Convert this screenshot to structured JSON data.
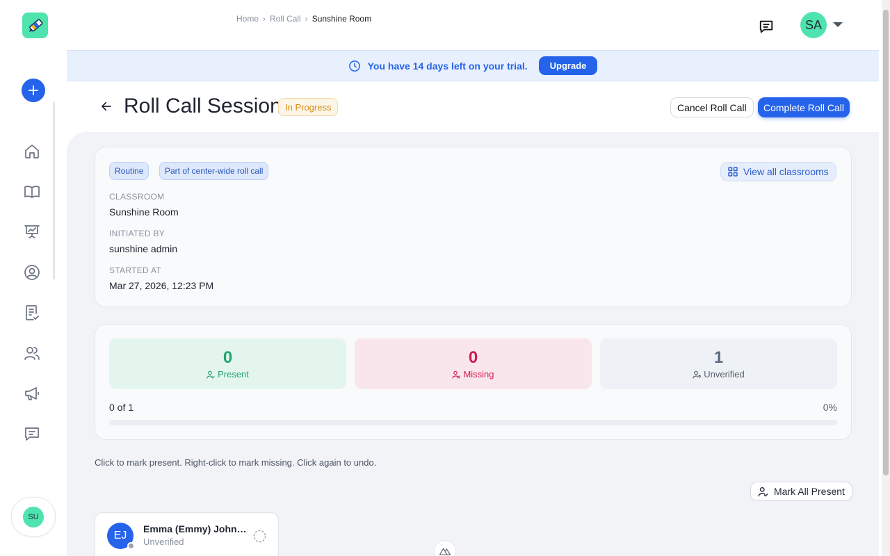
{
  "sidebar": {
    "logo_icon": "pencil-logo-icon",
    "add_icon": "plus-icon",
    "items": [
      {
        "icon": "home-icon"
      },
      {
        "icon": "book-icon"
      },
      {
        "icon": "presentation-chart-icon"
      },
      {
        "icon": "user-circle-icon"
      },
      {
        "icon": "clipboard-check-icon"
      },
      {
        "icon": "users-icon"
      },
      {
        "icon": "megaphone-icon"
      },
      {
        "icon": "message-square-icon"
      }
    ],
    "user_initials": "SU"
  },
  "header": {
    "breadcrumb": [
      "Home",
      "Roll Call",
      "Sunshine Room"
    ],
    "messages_icon": "message-square-text-icon",
    "user_initials": "SA"
  },
  "banner": {
    "text": "You have 14 days left on your trial.",
    "upgrade_label": "Upgrade"
  },
  "page": {
    "title": "Roll Call Session",
    "status": "In Progress",
    "cancel_label": "Cancel Roll Call",
    "complete_label": "Complete Roll Call"
  },
  "session": {
    "tags": [
      "Routine",
      "Part of center-wide roll call"
    ],
    "view_all_label": "View all classrooms",
    "fields": [
      {
        "label": "CLASSROOM",
        "value": "Sunshine Room"
      },
      {
        "label": "INITIATED BY",
        "value": "sunshine admin"
      },
      {
        "label": "STARTED AT",
        "value": "Mar 27, 2026, 12:23 PM"
      }
    ]
  },
  "stats": {
    "present": {
      "count": "0",
      "label": "Present"
    },
    "missing": {
      "count": "0",
      "label": "Missing"
    },
    "unverified": {
      "count": "1",
      "label": "Unverified"
    },
    "progress_text": "0 of 1",
    "progress_percent": "0%",
    "progress_fraction": 0
  },
  "instructions": "Click to mark present. Right-click to mark missing. Click again to undo.",
  "mark_all_label": "Mark All Present",
  "children": [
    {
      "initials": "EJ",
      "name": "Emma (Emmy) Johnson",
      "status": "Unverified"
    }
  ],
  "colors": {
    "accent": "#2563eb",
    "brand": "#4fe3ad",
    "present": "#21a36e",
    "missing": "#d21c4e",
    "warning": "#d48a10"
  }
}
